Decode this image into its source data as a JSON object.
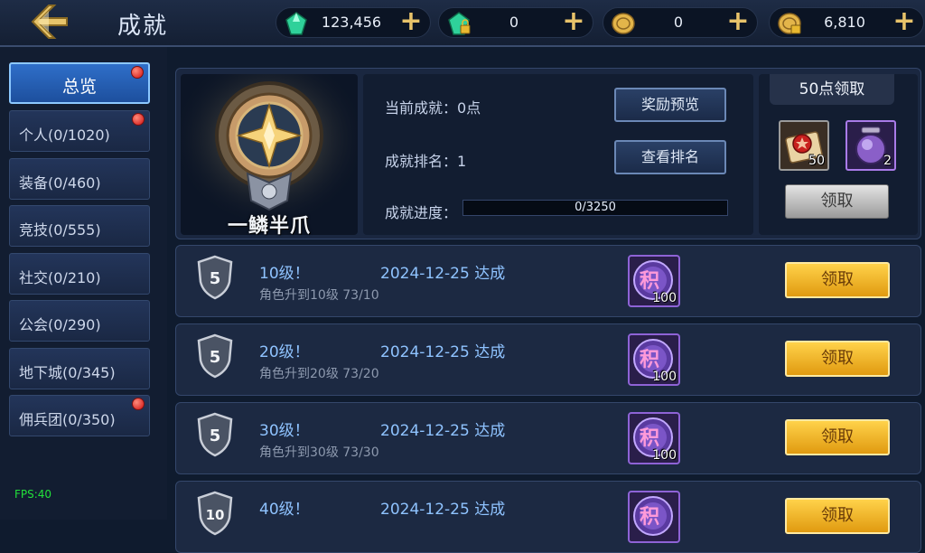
{
  "header": {
    "title": "成就",
    "currencies": [
      {
        "icon": "green-gem-icon",
        "value": "123,456"
      },
      {
        "icon": "locked-gem-icon",
        "value": "0"
      },
      {
        "icon": "gold-coin-icon",
        "value": "0"
      },
      {
        "icon": "locked-coin-icon",
        "value": "6,810"
      }
    ]
  },
  "sidebar": {
    "items": [
      {
        "label": "总览",
        "active": true,
        "dot": true
      },
      {
        "label": "个人(0/1020)",
        "active": false,
        "dot": true
      },
      {
        "label": "装备(0/460)",
        "active": false,
        "dot": false
      },
      {
        "label": "竞技(0/555)",
        "active": false,
        "dot": false
      },
      {
        "label": "社交(0/210)",
        "active": false,
        "dot": false
      },
      {
        "label": "公会(0/290)",
        "active": false,
        "dot": false
      },
      {
        "label": "地下城(0/345)",
        "active": false,
        "dot": false
      },
      {
        "label": "佣兵团(0/350)",
        "active": false,
        "dot": true
      }
    ],
    "fps": "FPS:40"
  },
  "summary": {
    "medal_name": "一鳞半爪",
    "current_label": "当前成就：0点",
    "rank_label": "成就排名：1",
    "progress_label": "成就进度：",
    "progress_text": "0/3250",
    "progress_fraction": 0,
    "preview_button": "奖励预览",
    "rank_button": "查看排名"
  },
  "reward": {
    "heading": "50点领取",
    "items": [
      {
        "icon": "red-scroll-icon",
        "count": "50"
      },
      {
        "icon": "purple-orb-icon",
        "count": "2"
      }
    ],
    "claim_button": "领取"
  },
  "achievements": [
    {
      "badge": "5",
      "name": "10级！",
      "date": "2024-12-25 达成",
      "desc": "角色升到10级 73/10",
      "reward_glyph": "积",
      "reward_count": "100",
      "button": "领取"
    },
    {
      "badge": "5",
      "name": "20级！",
      "date": "2024-12-25 达成",
      "desc": "角色升到20级 73/20",
      "reward_glyph": "积",
      "reward_count": "100",
      "button": "领取"
    },
    {
      "badge": "5",
      "name": "30级！",
      "date": "2024-12-25 达成",
      "desc": "角色升到30级 73/30",
      "reward_glyph": "积",
      "reward_count": "100",
      "button": "领取"
    },
    {
      "badge": "10",
      "name": "40级！",
      "date": "2024-12-25 达成",
      "desc": "",
      "reward_glyph": "积",
      "reward_count": "",
      "button": "领取"
    }
  ],
  "colors": {
    "accent_gold": "#e8c36a",
    "tab_active": "#2f6fc9",
    "link_blue": "#8fc3ff",
    "claim_gold": "#ffd24a"
  }
}
